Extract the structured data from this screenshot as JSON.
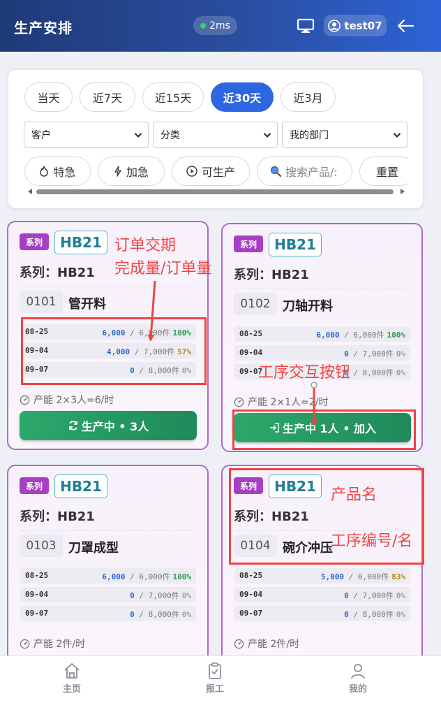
{
  "header": {
    "title": "生产安排",
    "latency": "2ms",
    "user": "test07",
    "icons": [
      "monitor-icon",
      "user-icon",
      "arrow-left-icon"
    ]
  },
  "filters": {
    "tabs": [
      {
        "label": "当天",
        "active": false
      },
      {
        "label": "近7天",
        "active": false
      },
      {
        "label": "近15天",
        "active": false
      },
      {
        "label": "近30天",
        "active": true
      },
      {
        "label": "近3月",
        "active": false
      }
    ],
    "selects": [
      {
        "value": "客户"
      },
      {
        "value": "分类"
      },
      {
        "value": "我的部门"
      }
    ],
    "chips": [
      {
        "label": "特急",
        "icon": "flame-icon"
      },
      {
        "label": "加急",
        "icon": "bolt-icon"
      },
      {
        "label": "可生产",
        "icon": "play-circle-icon"
      },
      {
        "label": "搜索产品/:",
        "icon": "search-icon"
      },
      {
        "label": "重置",
        "icon": ""
      }
    ]
  },
  "cards": [
    {
      "series_badge": "系列",
      "code": "HB21",
      "series_text": "系列：HB21",
      "proc_code": "0101",
      "proc_name": "管开料",
      "orders": [
        {
          "date": "08-25",
          "done": "6,000",
          "total": "6,000件",
          "pct": "100%",
          "tone": "g"
        },
        {
          "date": "09-04",
          "done": "4,000",
          "total": "7,000件",
          "pct": "57%",
          "tone": "y"
        },
        {
          "date": "09-07",
          "done": "0",
          "total": "8,000件",
          "pct": "0%",
          "tone": "z"
        }
      ],
      "capacity": "产能 2×3人=6/时",
      "action": "生产中 • 3人",
      "action_icon": "refresh-icon"
    },
    {
      "series_badge": "系列",
      "code": "HB21",
      "series_text": "系列：HB21",
      "proc_code": "0102",
      "proc_name": "刀轴开料",
      "orders": [
        {
          "date": "08-25",
          "done": "6,000",
          "total": "6,000件",
          "pct": "100%",
          "tone": "g"
        },
        {
          "date": "09-04",
          "done": "0",
          "total": "7,000件",
          "pct": "0%",
          "tone": "z"
        },
        {
          "date": "09-07",
          "done": "0",
          "total": "8,000件",
          "pct": "0%",
          "tone": "z"
        }
      ],
      "capacity": "产能 2×1人=2/时",
      "action": "生产中 1人 • 加入",
      "action_icon": "login-icon"
    },
    {
      "series_badge": "系列",
      "code": "HB21",
      "series_text": "系列：HB21",
      "proc_code": "0103",
      "proc_name": "刀罩成型",
      "orders": [
        {
          "date": "08-25",
          "done": "6,000",
          "total": "6,000件",
          "pct": "100%",
          "tone": "g"
        },
        {
          "date": "09-04",
          "done": "0",
          "total": "7,000件",
          "pct": "0%",
          "tone": "z"
        },
        {
          "date": "09-07",
          "done": "0",
          "total": "8,000件",
          "pct": "0%",
          "tone": "z"
        }
      ],
      "capacity": "产能 2件/时"
    },
    {
      "series_badge": "系列",
      "code": "HB21",
      "series_text": "系列：HB21",
      "proc_code": "0104",
      "proc_name": "碗介冲压",
      "orders": [
        {
          "date": "08-25",
          "done": "5,000",
          "total": "6,000件",
          "pct": "83%",
          "tone": "y"
        },
        {
          "date": "09-04",
          "done": "0",
          "total": "7,000件",
          "pct": "0%",
          "tone": "z"
        },
        {
          "date": "09-07",
          "done": "0",
          "total": "8,000件",
          "pct": "0%",
          "tone": "z"
        }
      ],
      "capacity": "产能 2件/时"
    }
  ],
  "annotations": {
    "order_due": "订单交期",
    "qty": "完成量/订单量",
    "action_btn": "工序交互按钮",
    "product_name": "产品名",
    "proc_id": "工序编号/名"
  },
  "nav": [
    {
      "label": "主页",
      "icon": "home-icon"
    },
    {
      "label": "报工",
      "icon": "clipboard-check-icon"
    },
    {
      "label": "我的",
      "icon": "user-icon"
    }
  ]
}
